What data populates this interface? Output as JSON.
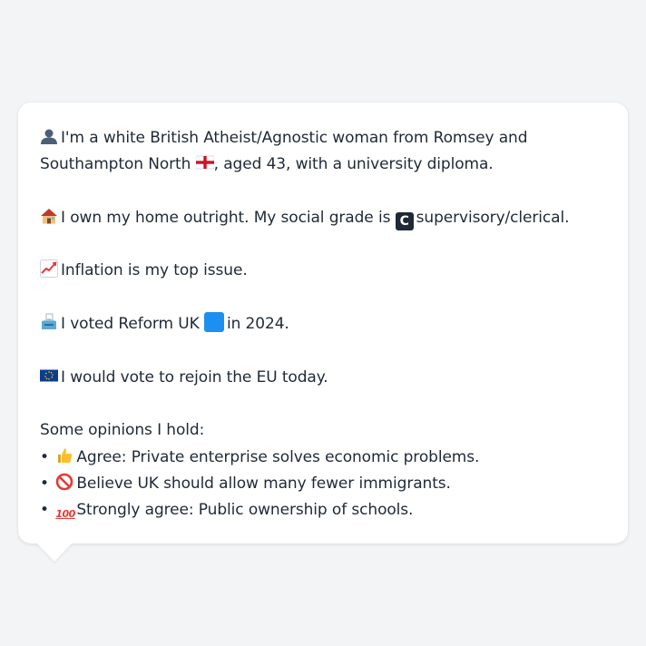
{
  "profile": {
    "line1_a": "I'm a white British Atheist/Agnostic woman from Romsey and Southampton North",
    "line1_b": ", aged 43, with a university diploma.",
    "line2_a": "I own my home outright. My social grade is",
    "line2_b": "supervisory/clerical.",
    "line3": "Inflation is my top issue.",
    "line4_a": "I voted Reform UK",
    "line4_b": "in 2024.",
    "line5": "I would vote to rejoin the EU today.",
    "opinions_heading": "Some opinions I hold:",
    "opinions": [
      {
        "icon": "thumbs-up-icon",
        "text": "Agree: Private enterprise solves economic problems."
      },
      {
        "icon": "prohibited-icon",
        "text": "Believe UK should allow many fewer immigrants."
      },
      {
        "icon": "hundred-points-icon",
        "text": "Strongly agree: Public ownership of schools."
      }
    ],
    "grade_letter": "C",
    "hundred_glyph": "100",
    "bullet_char": "•"
  },
  "icons": {
    "person": "bust-silhouette-icon",
    "flag": "england-flag-icon",
    "house": "house-icon",
    "grade": "grade-c-icon",
    "chart": "chart-increasing-icon",
    "ballot": "ballot-box-icon",
    "party": "blue-square-icon",
    "eu": "eu-flag-icon"
  },
  "colors": {
    "background": "#f3f4f6",
    "bubble": "#ffffff",
    "text": "#1f2937",
    "reform_blue": "#1d8ff0"
  }
}
